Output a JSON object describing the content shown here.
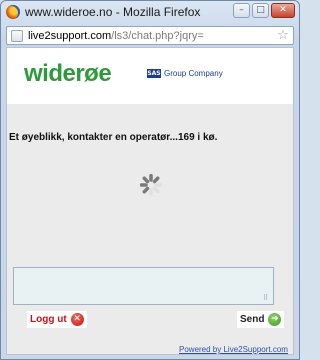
{
  "window": {
    "title": "www.wideroe.no - Mozilla Firefox",
    "minimize": "–",
    "maximize": "□",
    "close": "✕"
  },
  "addressbar": {
    "domain": "live2support.com",
    "path": "/ls3/chat.php?jqry=",
    "star": "☆"
  },
  "header": {
    "brand": "widerøe",
    "partner_badge": "SAS",
    "partner_text": "Group Company"
  },
  "chat": {
    "status": "Et øyeblikk, kontakter en operatør...169 i kø.",
    "input_value": "",
    "grip": "⠿"
  },
  "buttons": {
    "logout": "Logg ut",
    "logout_icon": "✕",
    "send": "Send",
    "send_icon": "➜"
  },
  "footer": {
    "powered_by": "Powered by Live2Support.com"
  },
  "colors": {
    "brand_green": "#2f9a3b",
    "logout_red": "#c0151b",
    "link_blue": "#2a4fb0"
  }
}
